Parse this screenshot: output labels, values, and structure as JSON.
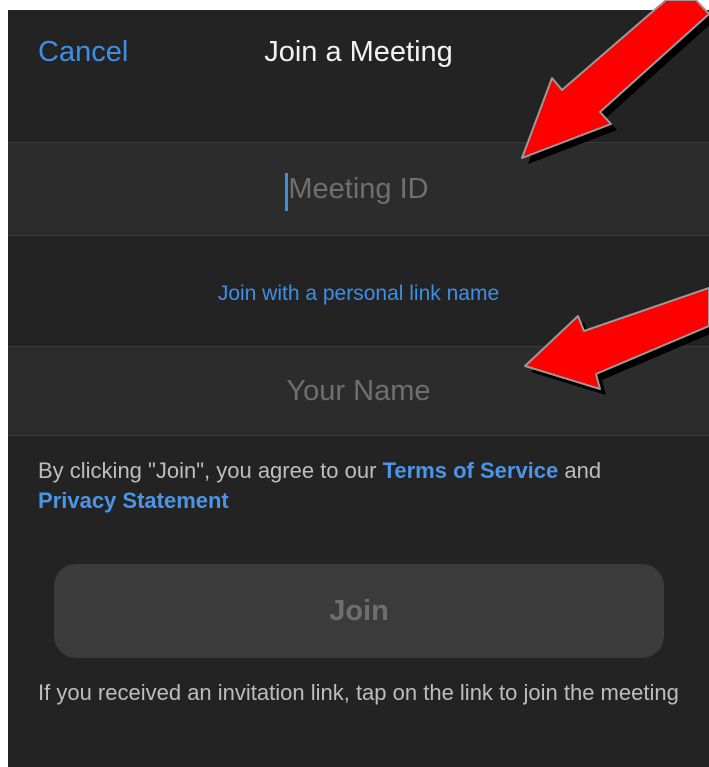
{
  "header": {
    "cancel_label": "Cancel",
    "title": "Join a Meeting"
  },
  "meeting_id": {
    "value": "",
    "placeholder": "Meeting ID"
  },
  "personal_link_label": "Join with a personal link name",
  "your_name": {
    "value": "",
    "placeholder": "Your Name"
  },
  "terms": {
    "prefix": "By clicking \"Join\", you agree to our ",
    "tos_label": "Terms of Service",
    "and_text": " and",
    "privacy_label": "Privacy Statement"
  },
  "join_button_label": "Join",
  "invite_note": "If you received an invitation link, tap on the link to join the meeting",
  "colors": {
    "background": "#232323",
    "field_background": "#2c2c2c",
    "accent": "#3d8fe6",
    "annotation_arrow": "#ff0000"
  },
  "annotations": {
    "arrow_icon": "red-arrow"
  }
}
